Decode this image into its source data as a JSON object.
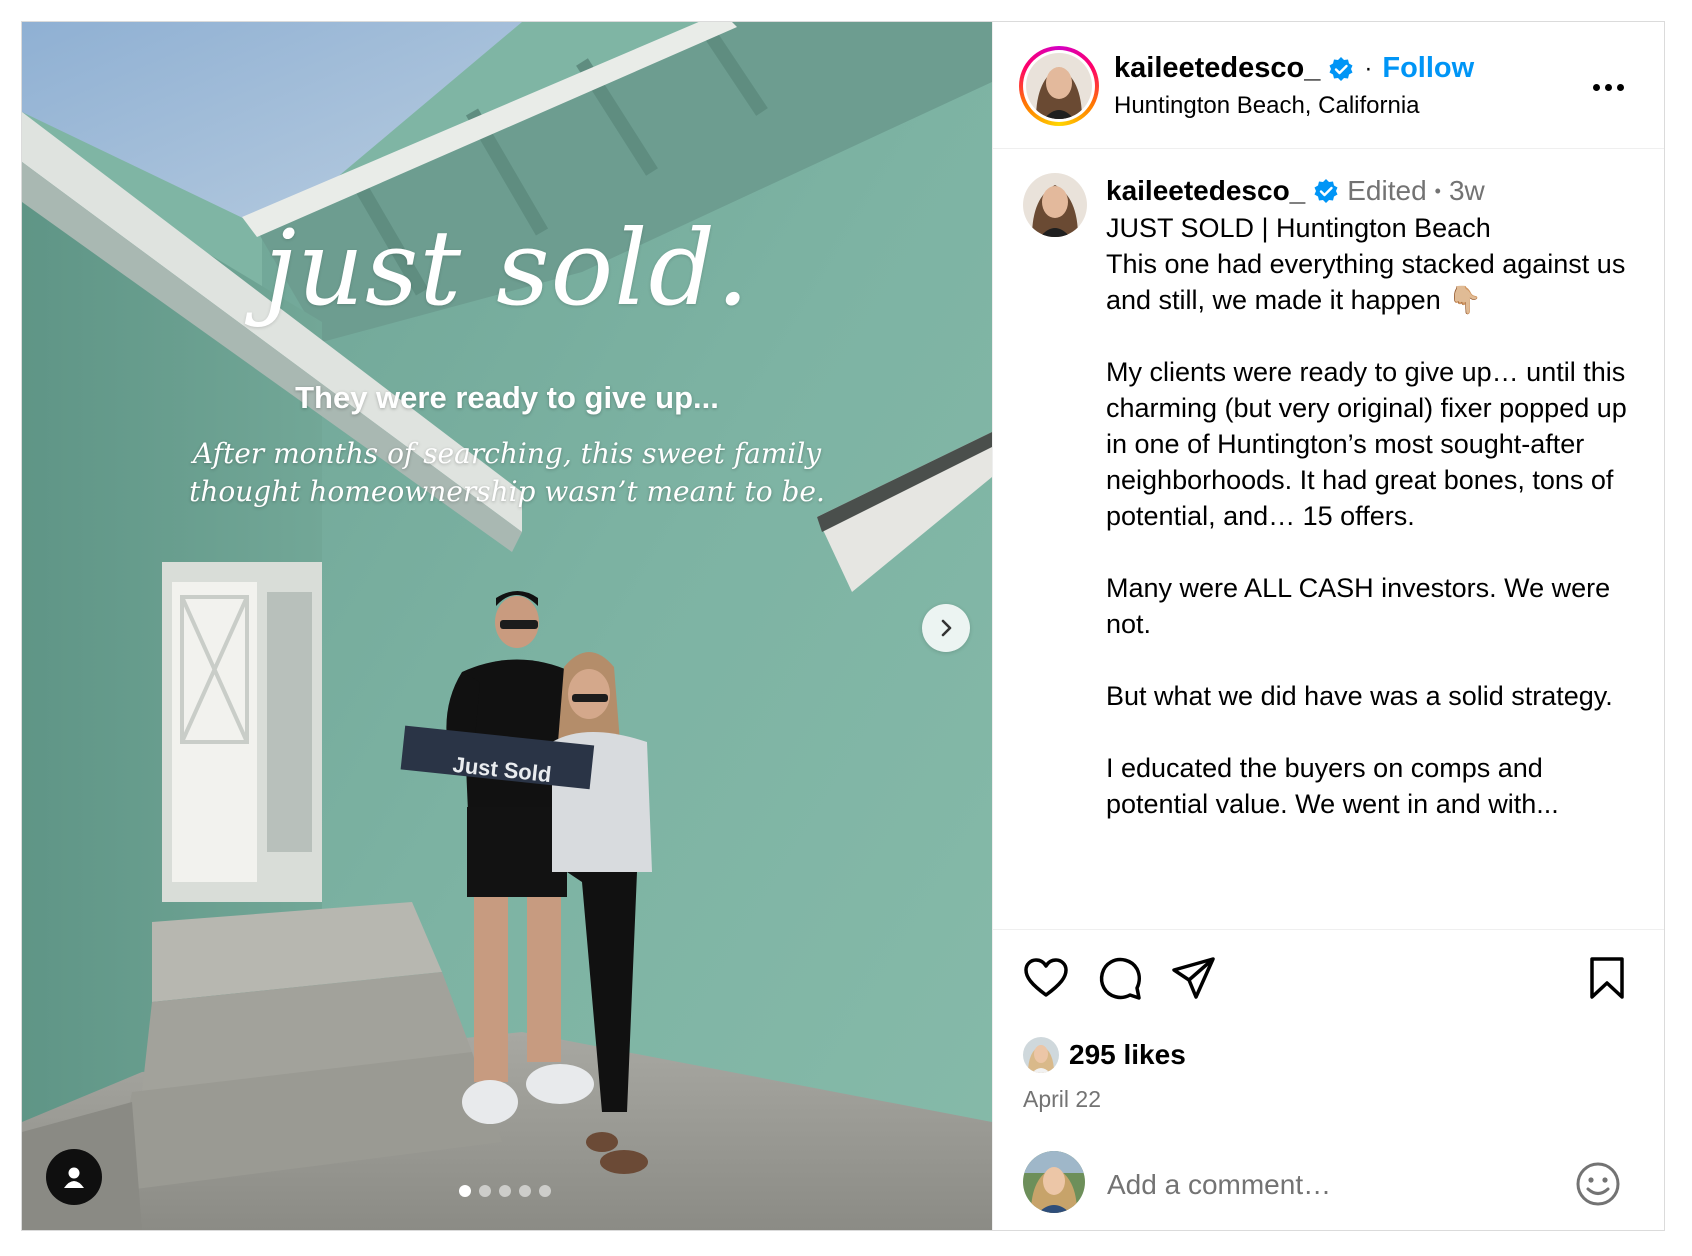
{
  "post": {
    "overlay": {
      "title": "just sold.",
      "subtitle": "They were ready to give up...",
      "body": "After months of searching, this sweet family thought homeownership wasn’t meant to be.",
      "sign_text": "Just Sold"
    },
    "carousel": {
      "total": 5,
      "current": 1
    }
  },
  "header": {
    "username": "kaileetedesco_",
    "separator": "·",
    "follow_label": "Follow",
    "location": "Huntington Beach, California"
  },
  "caption": {
    "username": "kaileetedesco_",
    "edited": "Edited",
    "dot": "•",
    "age": "3w",
    "paragraphs": [
      "JUST SOLD | Huntington Beach\nThis one had everything stacked against us\nand still, we made it happen 👇🏼",
      "My clients were ready to give up… until this charming (but very original) fixer popped up in one of Huntington’s most sought-after neighborhoods. It had great bones, tons of potential, and… 15 offers.",
      "Many were ALL CASH investors. We were not.",
      "But what we did have was a solid strategy.",
      "I educated the buyers on comps and potential value. We went in and with..."
    ]
  },
  "actions": {
    "like_icon": "heart-icon",
    "comment_icon": "comment-icon",
    "share_icon": "share-icon",
    "save_icon": "bookmark-icon"
  },
  "likes": "295 likes",
  "date": "April 22",
  "comment": {
    "placeholder": "Add a comment…",
    "emoji_icon": "emoji-icon"
  },
  "colors": {
    "follow_blue": "#0095f6",
    "verified_blue": "#0095f6",
    "meta_gray": "#737373",
    "wall_green": "#7fb5a4"
  }
}
